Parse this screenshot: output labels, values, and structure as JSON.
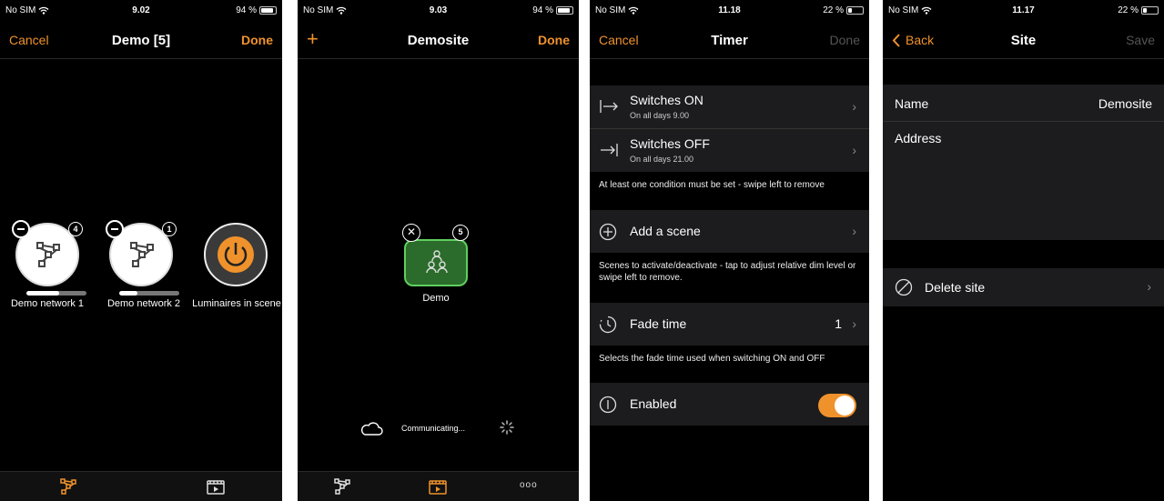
{
  "screen1": {
    "status": {
      "carrier": "No SIM",
      "time": "9.02",
      "battery": "94 %"
    },
    "nav": {
      "left": "Cancel",
      "title": "Demo [5]",
      "right": "Done"
    },
    "nodes": [
      {
        "label": "Demo network 1",
        "count": "4",
        "progress": 0.55
      },
      {
        "label": "Demo network 2",
        "count": "1",
        "progress": 0.3
      },
      {
        "label": "Luminaires in scene"
      }
    ]
  },
  "screen2": {
    "status": {
      "carrier": "No SIM",
      "time": "9.03",
      "battery": "94 %"
    },
    "nav": {
      "left": "+",
      "title": "Demosite",
      "right": "Done"
    },
    "scene": {
      "label": "Demo",
      "count": "5"
    },
    "communicating": "Communicating...",
    "tab_more": "ooo"
  },
  "screen3": {
    "status": {
      "carrier": "No SIM",
      "time": "11.18",
      "battery": "22 %"
    },
    "nav": {
      "left": "Cancel",
      "title": "Timer",
      "right": "Done"
    },
    "switches_on": {
      "title": "Switches ON",
      "sub": "On all days  9.00"
    },
    "switches_off": {
      "title": "Switches OFF",
      "sub": "On all days  21.00"
    },
    "note1": "At least one condition must be set - swipe left to remove",
    "add_scene": "Add a scene",
    "note2": "Scenes to activate/deactivate - tap to adjust relative dim level or swipe left to remove.",
    "fade": {
      "label": "Fade time",
      "value": "1"
    },
    "note3": "Selects the fade time used when switching ON and OFF",
    "enabled": {
      "label": "Enabled",
      "on": true
    }
  },
  "screen4": {
    "status": {
      "carrier": "No SIM",
      "time": "11.17",
      "battery": "22 %"
    },
    "nav": {
      "left": "Back",
      "title": "Site",
      "right": "Save"
    },
    "name_label": "Name",
    "name_value": "Demosite",
    "address_label": "Address",
    "delete": "Delete site"
  },
  "colors": {
    "accent": "#f0922c",
    "scene_green": "#2b6b2b",
    "scene_border": "#5fcf5f"
  }
}
